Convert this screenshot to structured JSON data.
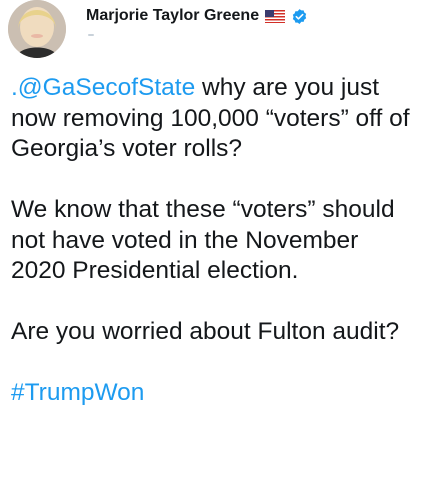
{
  "author": {
    "display_name": "Marjorie Taylor Greene"
  },
  "tweet": {
    "mention": ".@GaSecofState",
    "p1_rest": " why are you just now removing 100,000 “voters” off of Georgia’s voter rolls?",
    "p2": "We know that these “voters” should not have voted in the November 2020 Presidential election.",
    "p3": "Are you worried about Fulton audit?",
    "hashtag": "#TrumpWon"
  },
  "colors": {
    "link": "#1d9bf0",
    "verified": "#1d9bf0"
  }
}
